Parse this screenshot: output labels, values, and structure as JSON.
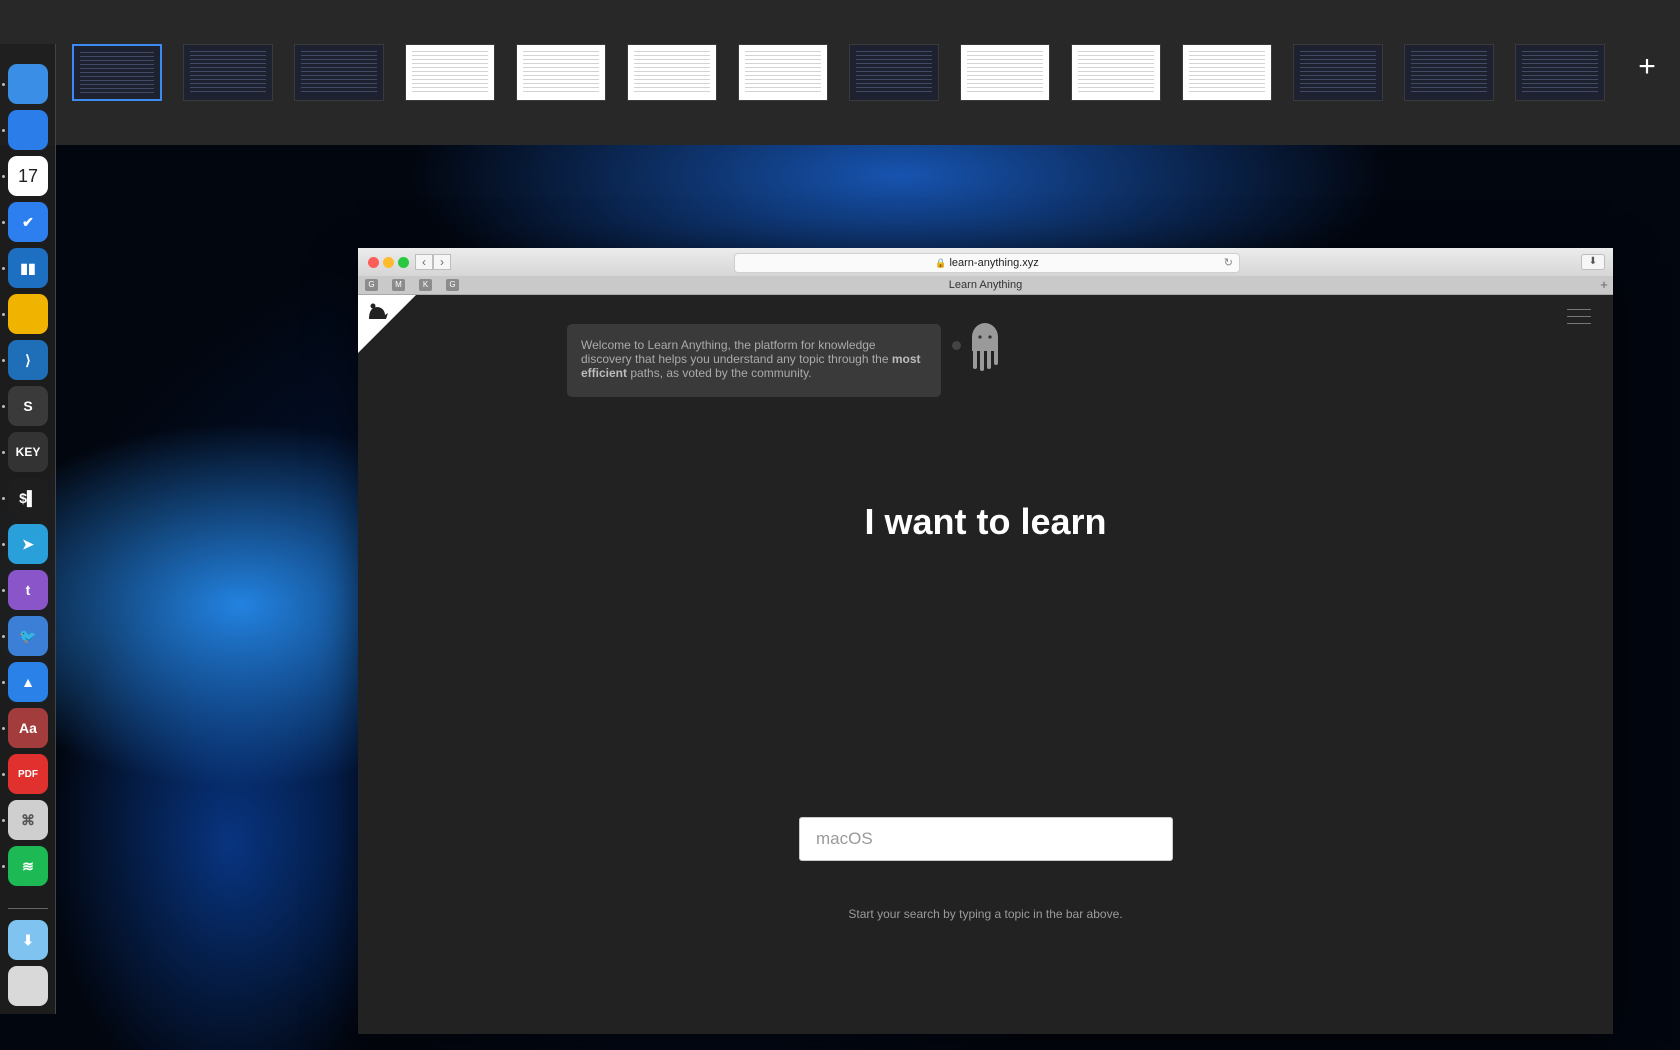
{
  "spaces_bar": {
    "add_space_label": "+",
    "thumbnails": [
      {
        "theme": "dark",
        "active": true
      },
      {
        "theme": "dark",
        "active": false
      },
      {
        "theme": "dark",
        "active": false
      },
      {
        "theme": "light",
        "active": false
      },
      {
        "theme": "light",
        "active": false
      },
      {
        "theme": "light",
        "active": false
      },
      {
        "theme": "light",
        "active": false
      },
      {
        "theme": "dark",
        "active": false
      },
      {
        "theme": "light",
        "active": false
      },
      {
        "theme": "light",
        "active": false
      },
      {
        "theme": "light",
        "active": false
      },
      {
        "theme": "dark",
        "active": false
      },
      {
        "theme": "dark",
        "active": false
      },
      {
        "theme": "dark",
        "active": false
      }
    ]
  },
  "dock": {
    "items": [
      {
        "icon": "finder-icon",
        "color": "#3a8ee6",
        "label": ""
      },
      {
        "icon": "safari-icon",
        "color": "#2b7de9",
        "label": ""
      },
      {
        "icon": "calendar-icon",
        "color": "#ffffff",
        "label": "17"
      },
      {
        "icon": "things-icon",
        "color": "#2d7ff0",
        "label": "✔"
      },
      {
        "icon": "trello-icon",
        "color": "#1d6fc1",
        "label": "▮▮"
      },
      {
        "icon": "istatistica-icon",
        "color": "#f0b400",
        "label": ""
      },
      {
        "icon": "vscode-icon",
        "color": "#1f6fb8",
        "label": "⟩"
      },
      {
        "icon": "sublime-text-icon",
        "color": "#3a3a3a",
        "label": "S"
      },
      {
        "icon": "keynote-icon",
        "color": "#333333",
        "label": "KEY"
      },
      {
        "icon": "terminal-icon",
        "color": "#1e1e1e",
        "label": "$▌"
      },
      {
        "icon": "telegram-icon",
        "color": "#2aa0da",
        "label": "➤"
      },
      {
        "icon": "tweetbot-plus-icon",
        "color": "#8a55c9",
        "label": "t"
      },
      {
        "icon": "tweetbot-icon",
        "color": "#3b7fd6",
        "label": "🐦"
      },
      {
        "icon": "spark-icon",
        "color": "#2a82e8",
        "label": "▲"
      },
      {
        "icon": "dictionary-icon",
        "color": "#a33c3c",
        "label": "Aa"
      },
      {
        "icon": "pdf-expert-icon",
        "color": "#e0312e",
        "label": "PDF"
      },
      {
        "icon": "script-editor-icon",
        "color": "#cfcfcf",
        "label": "⌘"
      },
      {
        "icon": "spotify-icon",
        "color": "#1db954",
        "label": "≋"
      },
      {
        "icon": "downloads-folder-icon",
        "color": "#7fc4f0",
        "label": "⬇"
      },
      {
        "icon": "trash-icon",
        "color": "#d9d9d9",
        "label": ""
      }
    ]
  },
  "browser": {
    "url": "learn-anything.xyz",
    "tab_title": "Learn Anything",
    "favorites": [
      "G",
      "M",
      "K",
      "G"
    ],
    "page": {
      "welcome_text_before": "Welcome to Learn Anything, the platform for knowledge discovery that helps you understand any topic through the ",
      "welcome_bold": "most efficient",
      "welcome_text_after": " paths, as voted by the community.",
      "headline": "I want to learn",
      "search_placeholder": "macOS",
      "hint": "Start your search by typing a topic in the bar above."
    }
  }
}
